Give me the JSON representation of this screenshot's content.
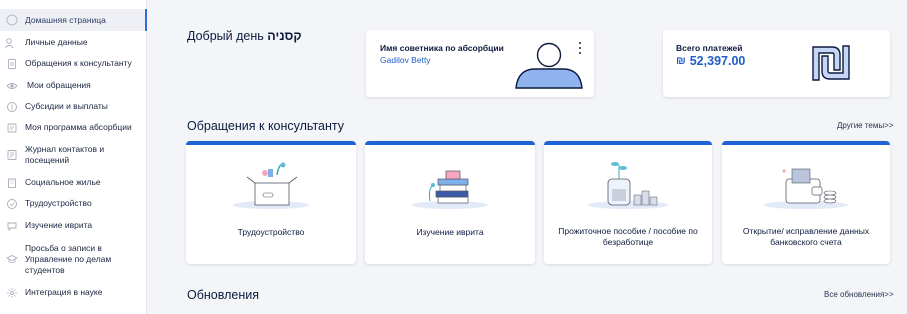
{
  "sidebar": {
    "items": [
      {
        "label": "Домашняя страница",
        "icon": "home-icon"
      },
      {
        "label": "Личные данные",
        "icon": "user-icon"
      },
      {
        "label": "Обращения к консультанту",
        "icon": "document-icon"
      },
      {
        "label": "Мои обращения",
        "icon": "eye-icon"
      },
      {
        "label": "Субсидии и выплаты",
        "icon": "coins-icon"
      },
      {
        "label": "Моя программа абсорбции",
        "icon": "list-icon"
      },
      {
        "label": "Журнал контактов и посещений",
        "icon": "journal-icon"
      },
      {
        "label": "Социальное жилье",
        "icon": "building-icon"
      },
      {
        "label": "Трудоустройство",
        "icon": "briefcase-icon"
      },
      {
        "label": "Изучение иврита",
        "icon": "chat-icon"
      },
      {
        "label": "Просьба о записи в Управление по делам студентов",
        "icon": "graduation-icon"
      },
      {
        "label": "Интеграция в науке",
        "icon": "atom-icon"
      }
    ]
  },
  "greeting": {
    "text": "Добрый день ",
    "name": "קסניה"
  },
  "advisor_card": {
    "title": "Имя советника по абсорбции",
    "name": "Gadilov Betty"
  },
  "payments_card": {
    "title": "Всего платежей",
    "currency": "₪",
    "amount": "52,397.00"
  },
  "consultant_section": {
    "title": "Обращения к консультанту",
    "more": "Другие темы>>",
    "tiles": [
      {
        "label": "Трудоустройство",
        "icon": "employment-box-icon"
      },
      {
        "label": "Изучение иврита",
        "icon": "books-icon"
      },
      {
        "label": "Прожиточное пособие / пособие по безработице",
        "icon": "money-plant-jar-icon"
      },
      {
        "label": "Открытие/ исправление данных банковского счета",
        "icon": "wallet-coins-icon"
      }
    ]
  },
  "updates_section": {
    "title": "Обновления",
    "more": "Все обновления>>"
  },
  "colors": {
    "accent": "#1e63d6",
    "link": "#1f5ec9",
    "text": "#0d1b3e",
    "background": "#f4f5f8"
  }
}
